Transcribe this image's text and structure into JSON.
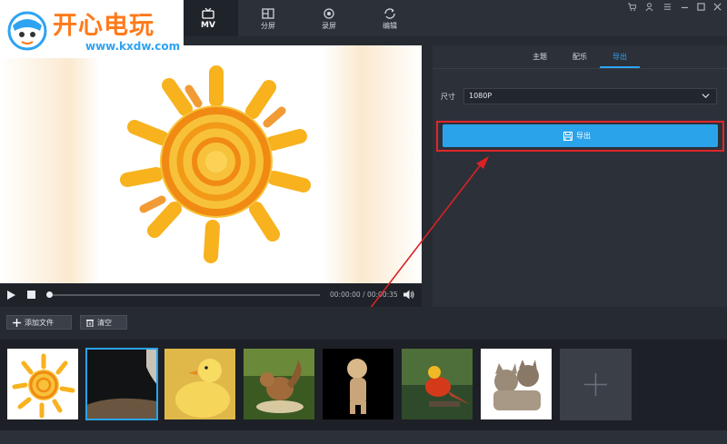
{
  "logo": {
    "brand": "开心电玩",
    "url": "www.kxdw.com"
  },
  "nav": {
    "tabs": [
      {
        "label": "MV",
        "icon": "tv-icon",
        "active": true
      },
      {
        "label": "分屏",
        "icon": "split-screen-icon"
      },
      {
        "label": "录屏",
        "icon": "record-icon"
      },
      {
        "label": "编辑",
        "icon": "refresh-edit-icon"
      }
    ]
  },
  "window": {
    "controls": [
      "cart-icon",
      "user-icon",
      "menu-icon",
      "minimize-icon",
      "maximize-icon",
      "close-icon"
    ]
  },
  "player": {
    "time_current": "00:00:00",
    "time_separator": " / ",
    "time_total": "00:00:35",
    "progress": 0.0
  },
  "panel": {
    "tabs": [
      {
        "label": "主题"
      },
      {
        "label": "配乐"
      },
      {
        "label": "导出",
        "active": true
      }
    ],
    "size_label": "尺寸",
    "size_value": "1080P",
    "export_label": "导出"
  },
  "toolbar": {
    "add_file_label": "添加文件",
    "clear_label": "清空"
  },
  "thumbnails": [
    {
      "subject": "sun-drawing"
    },
    {
      "subject": "dark-photo",
      "selected": true
    },
    {
      "subject": "duckling"
    },
    {
      "subject": "squirrel"
    },
    {
      "subject": "cheetah-cub"
    },
    {
      "subject": "pheasant"
    },
    {
      "subject": "kittens"
    }
  ],
  "colors": {
    "accent": "#2aa3ea",
    "highlight": "#e0262a",
    "brand": "#ff7a1a",
    "background": "#262a31"
  }
}
